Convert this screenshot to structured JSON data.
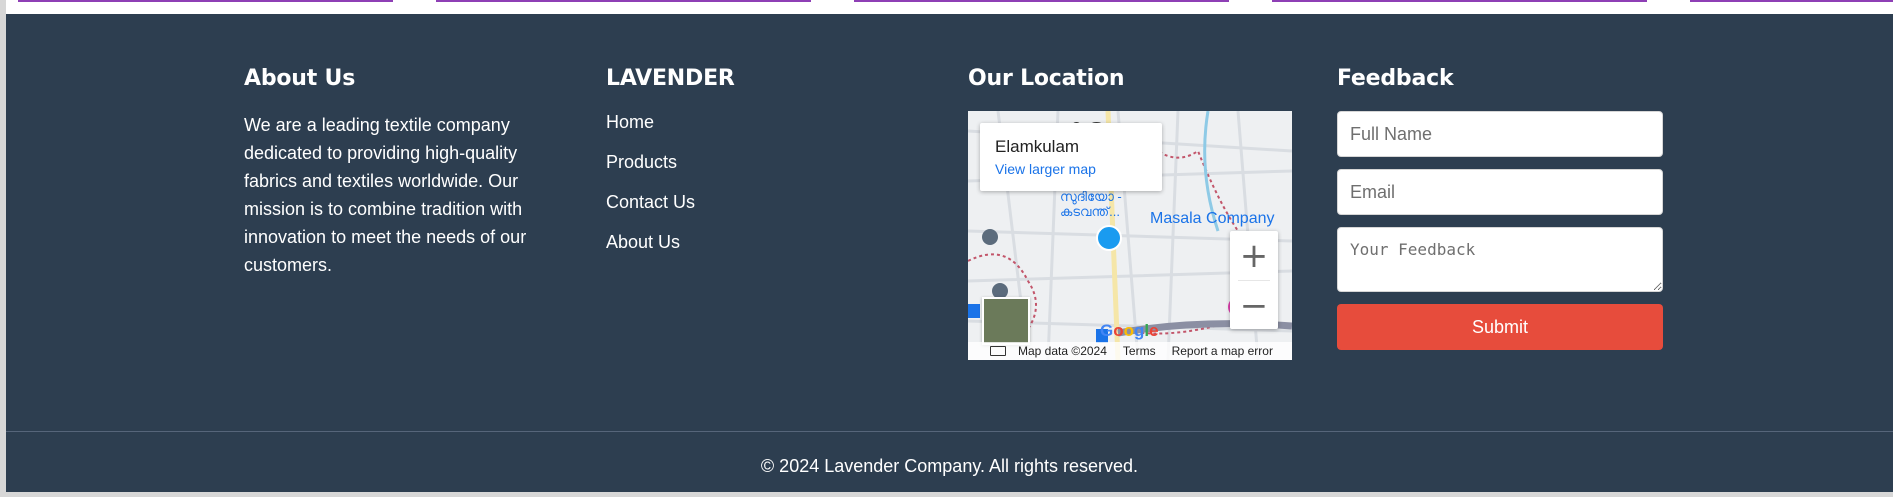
{
  "colors": {
    "footer_bg": "#2d3e50",
    "accent_line": "#8e3fb5",
    "submit_bg": "#e74c3c",
    "link_blue": "#1a73e8"
  },
  "about": {
    "title": "About Us",
    "text": "We are a leading textile company dedicated to providing high-quality fabrics and textiles worldwide. Our mission is to combine tradition with innovation to meet the needs of our customers."
  },
  "links": {
    "title": "LAVENDER",
    "items": [
      "Home",
      "Products",
      "Contact Us",
      "About Us"
    ]
  },
  "location": {
    "title": "Our Location",
    "map": {
      "place_name": "Elamkulam",
      "larger_map_link": "View larger map",
      "zoom_in": "+",
      "zoom_out": "−",
      "masala_label": "Masala Company",
      "top_label": "കുളം",
      "small_label_1": "സുദിയോ -",
      "small_label_2": "കടവന്ത്...",
      "logo": "Google",
      "attr_data": "Map data ©2024",
      "attr_terms": "Terms",
      "attr_report": "Report a map error"
    }
  },
  "feedback": {
    "title": "Feedback",
    "name_placeholder": "Full Name",
    "email_placeholder": "Email",
    "feedback_placeholder": "Your Feedback",
    "submit_label": "Submit"
  },
  "footer": {
    "copyright": "© 2024 Lavender Company. All rights reserved."
  }
}
